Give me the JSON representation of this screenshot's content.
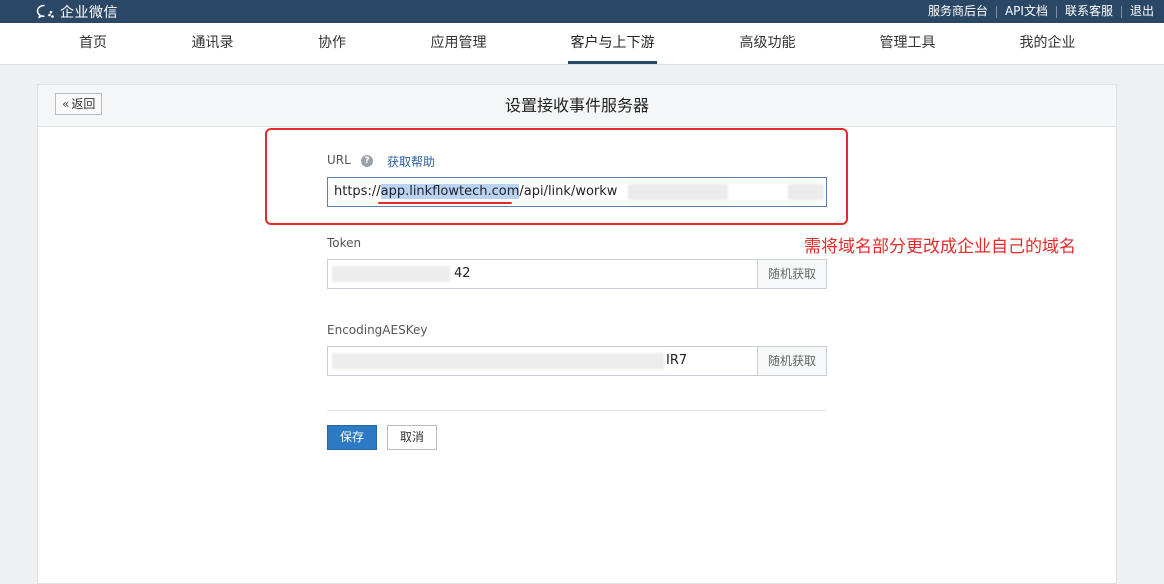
{
  "topbar": {
    "logo_text": "企业微信",
    "links": [
      "服务商后台",
      "API文档",
      "联系客服",
      "退出"
    ]
  },
  "nav": {
    "items": [
      "首页",
      "通讯录",
      "协作",
      "应用管理",
      "客户与上下游",
      "高级功能",
      "管理工具",
      "我的企业"
    ],
    "active": "客户与上下游"
  },
  "panel": {
    "back_label": "返回",
    "title": "设置接收事件服务器"
  },
  "form": {
    "url_label": "URL",
    "help_link": "获取帮助",
    "url_value": {
      "prefix": "https://",
      "highlighted": "app.linkflowtech.com",
      "suffix": "/api/link/workw"
    },
    "token_label": "Token",
    "token_value_tail": "42",
    "aes_label": "EncodingAESKey",
    "aes_value_tail": "IR7",
    "random_label": "随机获取",
    "save_label": "保存",
    "cancel_label": "取消"
  },
  "annotation": {
    "text": "需将域名部分更改成企业自己的域名",
    "color": "#e52a2a"
  },
  "colors": {
    "topbar": "#2b4766",
    "primary_button": "#2d79c4",
    "link": "#2b5f9e"
  }
}
